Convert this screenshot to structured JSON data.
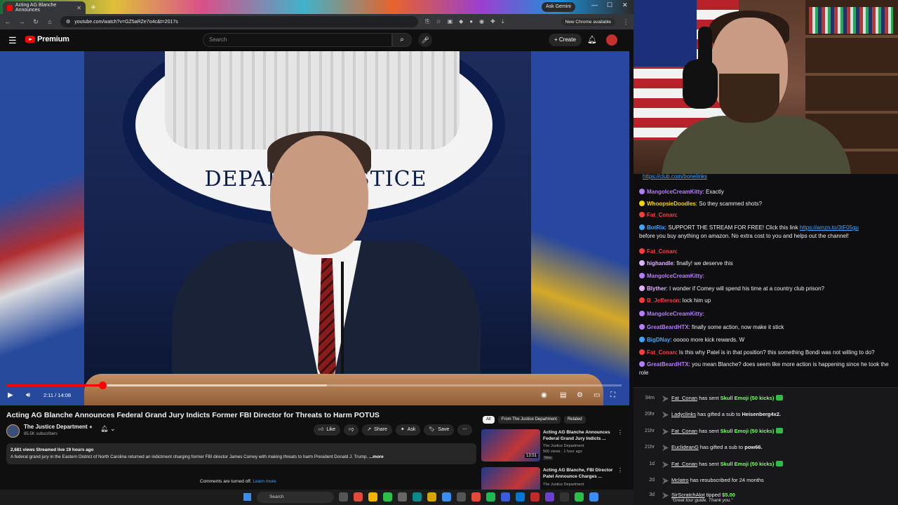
{
  "browser": {
    "tab_title": "Acting AG Blanche Announces",
    "url": "youtube.com/watch?v=GZ5aRZe7o4c&t=2017s",
    "ask_gemini": "Ask Gemini",
    "new_chrome": "New Chrome available"
  },
  "youtube": {
    "logo": "Premium",
    "search_placeholder": "Search",
    "create_label": "Create",
    "seal_text": "DEPARTM    JUSTICE",
    "player": {
      "timecode": "2:11 / 14:08",
      "progress_fraction": 0.155,
      "buffer_fraction": 0.52
    },
    "video_title": "Acting AG Blanche Announces Federal Grand Jury Indicts Former FBI Director for Threats to Harm POTUS",
    "channel": {
      "name": "The Justice Department",
      "subs": "85.5K subscribers"
    },
    "actions": {
      "like": "Like",
      "share": "Share",
      "ask": "Ask",
      "save": "Save"
    },
    "description": {
      "meta": "2,681 views  Streamed live 19 hours ago",
      "text": "A federal grand jury in the Eastern District of North Carolina returned an indictment charging former FBI director James Comey with making threats to harm President Donald J. Trump.",
      "more": "...more"
    },
    "comments_off": "Comments are turned off.",
    "learn_more": "Learn more",
    "chips": [
      "All",
      "From The Justice Department",
      "Related"
    ],
    "recs": [
      {
        "title": "Acting AG Blanche Announces Federal Grand Jury Indicts ...",
        "channel": "The Justice Department",
        "meta": "500 views · 1 hour ago",
        "badge": "New",
        "duration": "13:51"
      },
      {
        "title": "Acting AG Blanche, FBI Director Patel Announce Charges ...",
        "channel": "The Justice Department",
        "meta": "",
        "badge": "",
        "duration": ""
      }
    ]
  },
  "taskbar": {
    "search": "Search"
  },
  "chat": {
    "top_link": "https://club.com/bonelinks",
    "messages": [
      {
        "user": "MangoIceCreamKitty",
        "color": "#b57cff",
        "text": "Exactly"
      },
      {
        "user": "WhoopsieDoodles",
        "color": "#f5d300",
        "text": "So they scammed shots?"
      },
      {
        "user": "Fat_Conan",
        "color": "#ff3b3b",
        "text": ""
      },
      {
        "user": "BotRix",
        "color": "#3ea6ff",
        "text": "SUPPORT THE STREAM FOR FREE! Click this link",
        "link": "https://amzn.to/3tF05gu",
        "text2": "before you buy anything on amazon. No extra cost to you and helps out the channel!"
      },
      {
        "user": "Fat_Conan",
        "color": "#ff3b3b",
        "text": ""
      },
      {
        "user": "highandle",
        "color": "#e0b0ff",
        "text": "finally! we deserve this"
      },
      {
        "user": "MangoIceCreamKitty",
        "color": "#b57cff",
        "text": ""
      },
      {
        "user": "Blyther",
        "color": "#e0b0ff",
        "text": "I wonder if Comey will spend his time at a country club prison?"
      },
      {
        "user": "B_Jefferson",
        "color": "#ff3b3b",
        "text": "lock him up"
      },
      {
        "user": "MangoIceCreamKitty",
        "color": "#b57cff",
        "text": ""
      },
      {
        "user": "GreatBeardHTX",
        "color": "#b57cff",
        "text": "finally some action, now make it stick"
      },
      {
        "user": "BigDNay",
        "color": "#3ea6ff",
        "text": "ooooo more kick rewards. W"
      },
      {
        "user": "Fat_Conan",
        "color": "#ff3b3b",
        "text": "Is this why Patel is in that position? this something Bondi was not willing to do?"
      },
      {
        "user": "GreatBeardHTX",
        "color": "#b57cff",
        "text": "you mean Blanche? does seem like more action is happening since he took the role"
      }
    ]
  },
  "events": [
    {
      "time": "34m",
      "user": "Fat_Conan",
      "pre": "has sent",
      "item": "Skull Emoji (50 kicks)",
      "post": ""
    },
    {
      "time": "20hr",
      "user": "Ladyclinks",
      "pre": "has gifted a sub to",
      "item": "",
      "post": "Heisenberg4x2."
    },
    {
      "time": "21hr",
      "user": "Fat_Conan",
      "pre": "has sent",
      "item": "Skull Emoji (50 kicks)",
      "post": ""
    },
    {
      "time": "21hr",
      "user": "EuclideanG",
      "pre": "has gifted a sub to",
      "item": "",
      "post": "pow66."
    },
    {
      "time": "1d",
      "user": "Fat_Conan",
      "pre": "has sent",
      "item": "Skull Emoji (50 kicks)",
      "post": ""
    },
    {
      "time": "2d",
      "user": "Mclatro",
      "pre": "has resubscribed for 24 months",
      "item": "",
      "post": ""
    },
    {
      "time": "3d",
      "user": "SirScratchAlot",
      "pre": "tipped",
      "item": "$5.00",
      "post": ""
    }
  ],
  "event_note": "\"Great tour guide. Thank you.\""
}
